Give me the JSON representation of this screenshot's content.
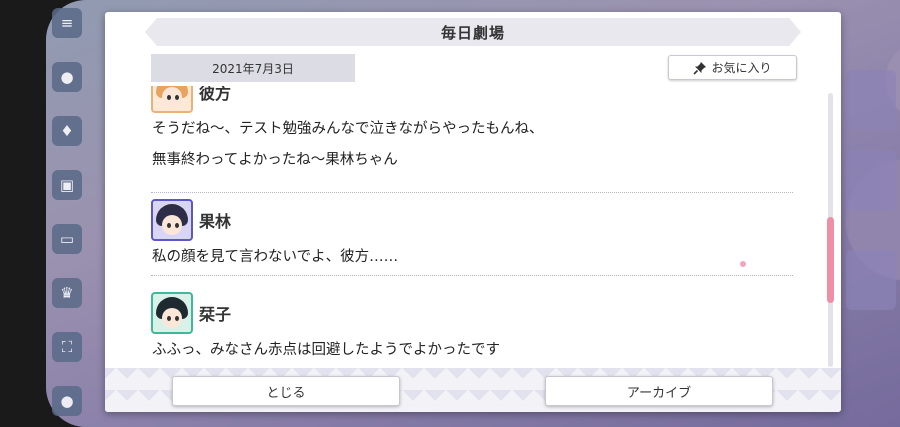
{
  "dialog": {
    "title": "毎日劇場",
    "date": "2021年7月3日",
    "favorite_label": "お気に入り",
    "close_label": "とじる",
    "archive_label": "アーカイブ"
  },
  "messages": [
    {
      "speaker": "彼方",
      "lines": [
        "そうだね〜、テスト勉強みんなで泣きながらやったもんね、",
        "無事終わってよかったね〜果林ちゃん"
      ]
    },
    {
      "speaker": "果林",
      "lines": [
        "私の顔を見て言わないでよ、彼方……"
      ]
    },
    {
      "speaker": "栞子",
      "lines": [
        "ふふっ、みなさん赤点は回避したようでよかったです"
      ]
    }
  ],
  "colors": {
    "scroll_thumb": "#ef8fa6",
    "avatar_kanata": "#e8b27a",
    "avatar_karin": "#5b57c9",
    "avatar_shioriko": "#3fb89a"
  },
  "icons": {
    "favorite": "pin-icon",
    "side_menu": [
      "menu-icon",
      "chat-icon",
      "present-icon",
      "gift-icon",
      "screen-icon",
      "trophy-icon",
      "fullscreen-icon",
      "profile-icon"
    ]
  }
}
